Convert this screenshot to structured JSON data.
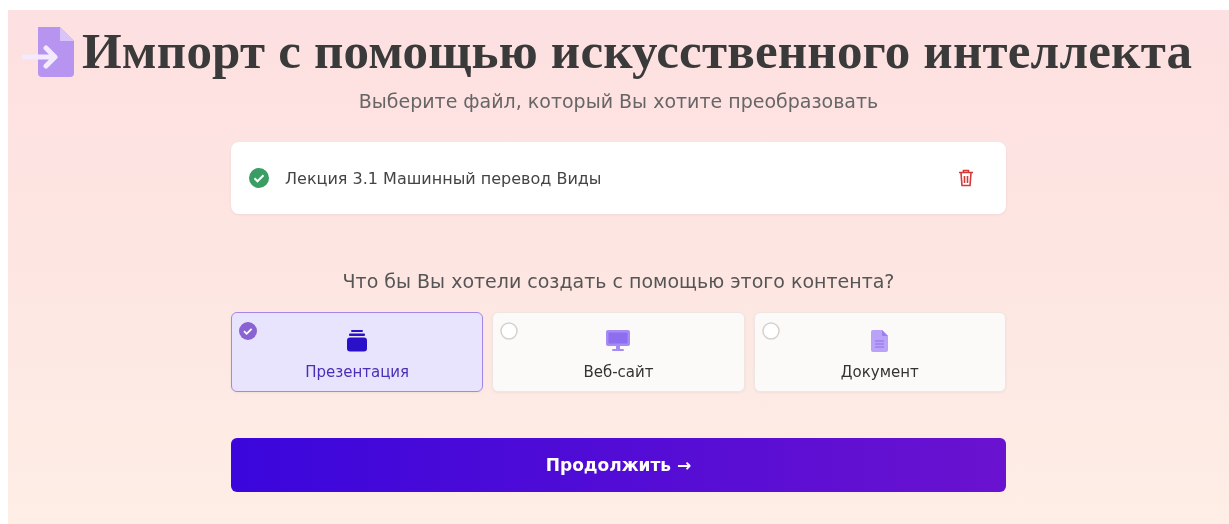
{
  "header": {
    "title": "Импорт с помощью искусственного интеллекта",
    "subtitle": "Выберите файл, который Вы хотите преобразовать"
  },
  "file": {
    "name": "Лекция 3.1 Машинный перевод Виды",
    "uploaded": true
  },
  "question": "Что бы Вы хотели создать с помощью этого контента?",
  "options": [
    {
      "kind": "presentation",
      "label": "Презентация",
      "selected": true
    },
    {
      "kind": "website",
      "label": "Веб-сайт",
      "selected": false
    },
    {
      "kind": "document",
      "label": "Документ",
      "selected": false
    }
  ],
  "continue_button": {
    "label": "Продолжить",
    "arrow": "→"
  }
}
